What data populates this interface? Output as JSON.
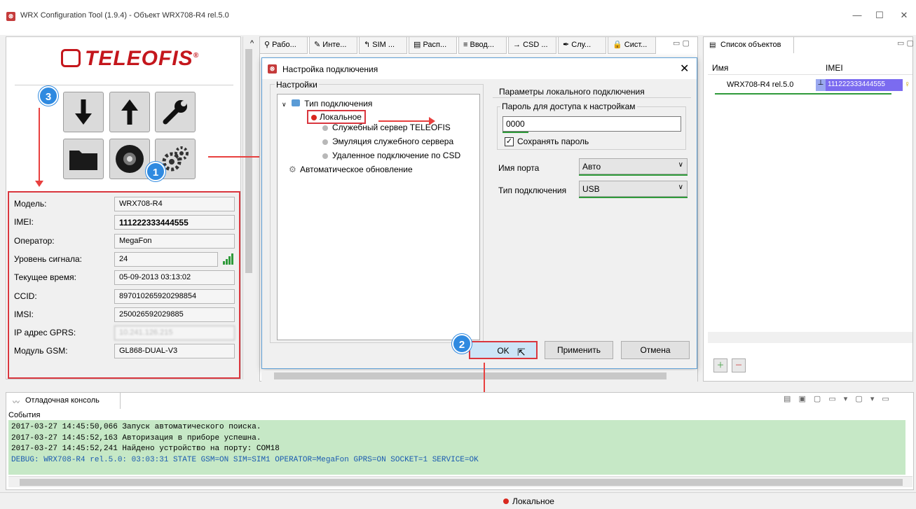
{
  "window": {
    "title": "WRX Configuration Tool (1.9.4) - Объект WRX708-R4 rel.5.0"
  },
  "logo": {
    "text": "TELEOFIS"
  },
  "callouts": {
    "one": "1",
    "two": "2",
    "three": "3"
  },
  "device_info": [
    {
      "label": "Модель:",
      "value": "WRX708-R4"
    },
    {
      "label": "IMEI:",
      "value": "111222333444555"
    },
    {
      "label": "Оператор:",
      "value": "MegaFon"
    },
    {
      "label": "Уровень сигнала:",
      "value": "24"
    },
    {
      "label": "Текущее время:",
      "value": "05-09-2013 03:13:02"
    },
    {
      "label": "CCID:",
      "value": "897010265920298854"
    },
    {
      "label": "IMSI:",
      "value": "250026592029885"
    },
    {
      "label": "IP адрес GPRS:",
      "value": "10.241.126.215"
    },
    {
      "label": "Модуль GSM:",
      "value": "GL868-DUAL-V3"
    }
  ],
  "tabs": [
    {
      "label": "Рабо..."
    },
    {
      "label": "Инте..."
    },
    {
      "label": "SIM ..."
    },
    {
      "label": "Расп..."
    },
    {
      "label": "Ввод..."
    },
    {
      "label": "CSD ..."
    },
    {
      "label": "Слу..."
    },
    {
      "label": "Сист..."
    }
  ],
  "dialog": {
    "title": "Настройка подключения",
    "settings_legend": "Настройки",
    "tree": {
      "root": "Тип подключения",
      "items": [
        "Локальное",
        "Служебный сервер TELEOFIS",
        "Эмуляция служебного сервера",
        "Удаленное подключение по CSD"
      ],
      "auto_update": "Автоматическое обновление"
    },
    "params_title": "Параметры локального подключения",
    "password_group": "Пароль для доступа к настройкам",
    "password_value": "0000",
    "save_password": "Сохранять пароль",
    "port_label": "Имя порта",
    "port_value": "Авто",
    "conn_type_label": "Тип подключения",
    "conn_type_value": "USB",
    "ok": "OK",
    "apply": "Применить",
    "cancel": "Отмена"
  },
  "objects_panel": {
    "tab": "Список объектов",
    "col_name": "Имя",
    "col_imei": "IMEI",
    "row_name": "WRX708-R4 rel.5.0",
    "row_imei": "111222333444555"
  },
  "console": {
    "tab": "Отладочная консоль",
    "events": "События",
    "lines": [
      "2017-03-27 14:45:50,066 Запуск автоматического поиска.",
      "2017-03-27 14:45:52,163 Авторизация в приборе успешна.",
      "2017-03-27 14:45:52,241 Найдено устройство на порту: COM18"
    ],
    "debug_line": "DEBUG: WRX708-R4 rel.5.0: 03:03:31 STATE GSM=ON SIM=SIM1 OPERATOR=MegaFon GPRS=ON SOCKET=1 SERVICE=OK"
  },
  "status": {
    "connection": "Локальное"
  },
  "colors": {
    "accent_red": "#d9363e",
    "badge_blue": "#2f8ae0",
    "console_bg": "#c6e8c6"
  }
}
